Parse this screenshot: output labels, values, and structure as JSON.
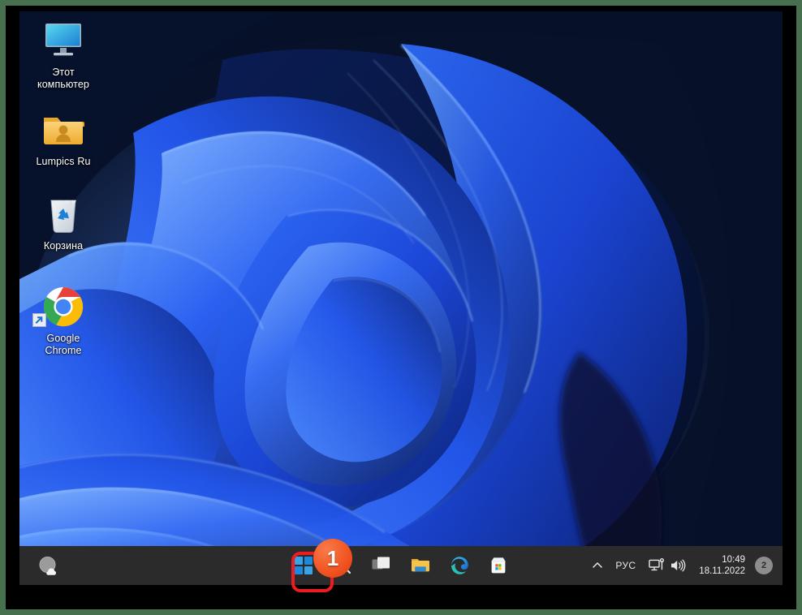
{
  "os": {
    "name": "Windows 11",
    "wallpaper": "bloom-blue",
    "theme_background": "#081530"
  },
  "desktop": {
    "icons": [
      {
        "id": "this-pc",
        "label": "Этот\nкомпьютер",
        "label_line1": "Этот",
        "label_line2": "компьютер",
        "icon": "monitor-icon",
        "shortcut": false
      },
      {
        "id": "lumpics-ru",
        "label": "Lumpics Ru",
        "label_line1": "Lumpics Ru",
        "label_line2": "",
        "icon": "user-folder-icon",
        "shortcut": false
      },
      {
        "id": "recycle-bin",
        "label": "Корзина",
        "label_line1": "Корзина",
        "label_line2": "",
        "icon": "recycle-bin-icon",
        "shortcut": false
      },
      {
        "id": "google-chrome",
        "label": "Google Chrome",
        "label_line1": "Google",
        "label_line2": "Chrome",
        "icon": "chrome-icon",
        "shortcut": true
      }
    ]
  },
  "taskbar": {
    "background": "#2b2b2b",
    "widget": {
      "name": "weather-widget",
      "icon": "cloud-sun-icon"
    },
    "buttons": [
      {
        "id": "start",
        "name": "start-button",
        "icon": "windows-logo-icon",
        "tooltip": "Пуск",
        "highlighted": true
      },
      {
        "id": "search",
        "name": "search-button",
        "icon": "search-icon",
        "tooltip": "Поиск",
        "highlighted": false
      },
      {
        "id": "task-view",
        "name": "task-view-button",
        "icon": "task-view-icon",
        "tooltip": "Представление задач",
        "highlighted": false
      },
      {
        "id": "file-explorer",
        "name": "file-explorer-button",
        "icon": "folder-icon",
        "tooltip": "Проводник",
        "highlighted": false
      },
      {
        "id": "edge",
        "name": "edge-button",
        "icon": "edge-icon",
        "tooltip": "Microsoft Edge",
        "highlighted": false
      },
      {
        "id": "store",
        "name": "store-button",
        "icon": "store-icon",
        "tooltip": "Microsoft Store",
        "highlighted": false
      }
    ],
    "tray": {
      "chevron": {
        "name": "show-hidden-icons",
        "glyph": "^"
      },
      "language": "РУС",
      "network_icon": "network-icon",
      "volume_icon": "volume-icon",
      "time": "10:49",
      "date": "18.11.2022",
      "notification_count": "2"
    }
  },
  "annotation": {
    "step_number": "1",
    "badge_color": "#ef5421",
    "highlight_color": "#ed1c24",
    "target": "start-button"
  },
  "frame": {
    "border_color": "#47704f",
    "letterbox_color": "#000000"
  }
}
